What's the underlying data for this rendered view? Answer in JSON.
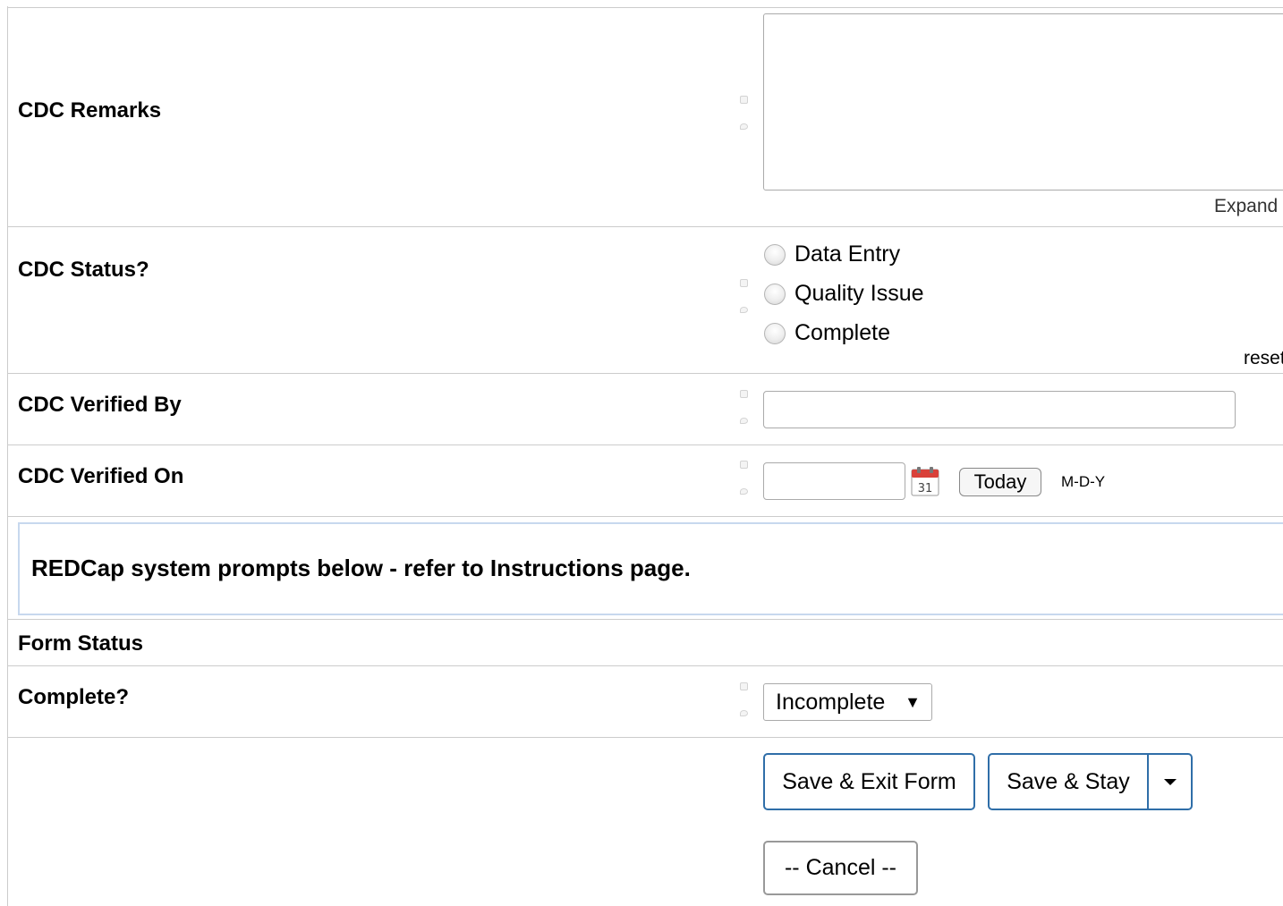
{
  "fields": {
    "remarks": {
      "label": "CDC Remarks",
      "value": "",
      "expand_link": "Expand"
    },
    "status": {
      "label": "CDC Status?",
      "options": [
        "Data Entry",
        "Quality Issue",
        "Complete"
      ],
      "reset_link": "reset"
    },
    "verified_by": {
      "label": "CDC Verified By",
      "value": ""
    },
    "verified_on": {
      "label": "CDC Verified On",
      "value": "",
      "today_button": "Today",
      "format_hint": "M-D-Y"
    }
  },
  "section_prompt": "REDCap system prompts below - refer to Instructions page.",
  "form_status": {
    "header": "Form Status",
    "complete_label": "Complete?",
    "complete_value": "Incomplete"
  },
  "actions": {
    "save_exit": "Save & Exit Form",
    "save_stay": "Save & Stay",
    "cancel": "-- Cancel --"
  },
  "icons": {
    "history": "history-icon",
    "comment": "comment-icon",
    "calendar": "calendar-icon",
    "dropdown": "chevron-down-icon"
  }
}
